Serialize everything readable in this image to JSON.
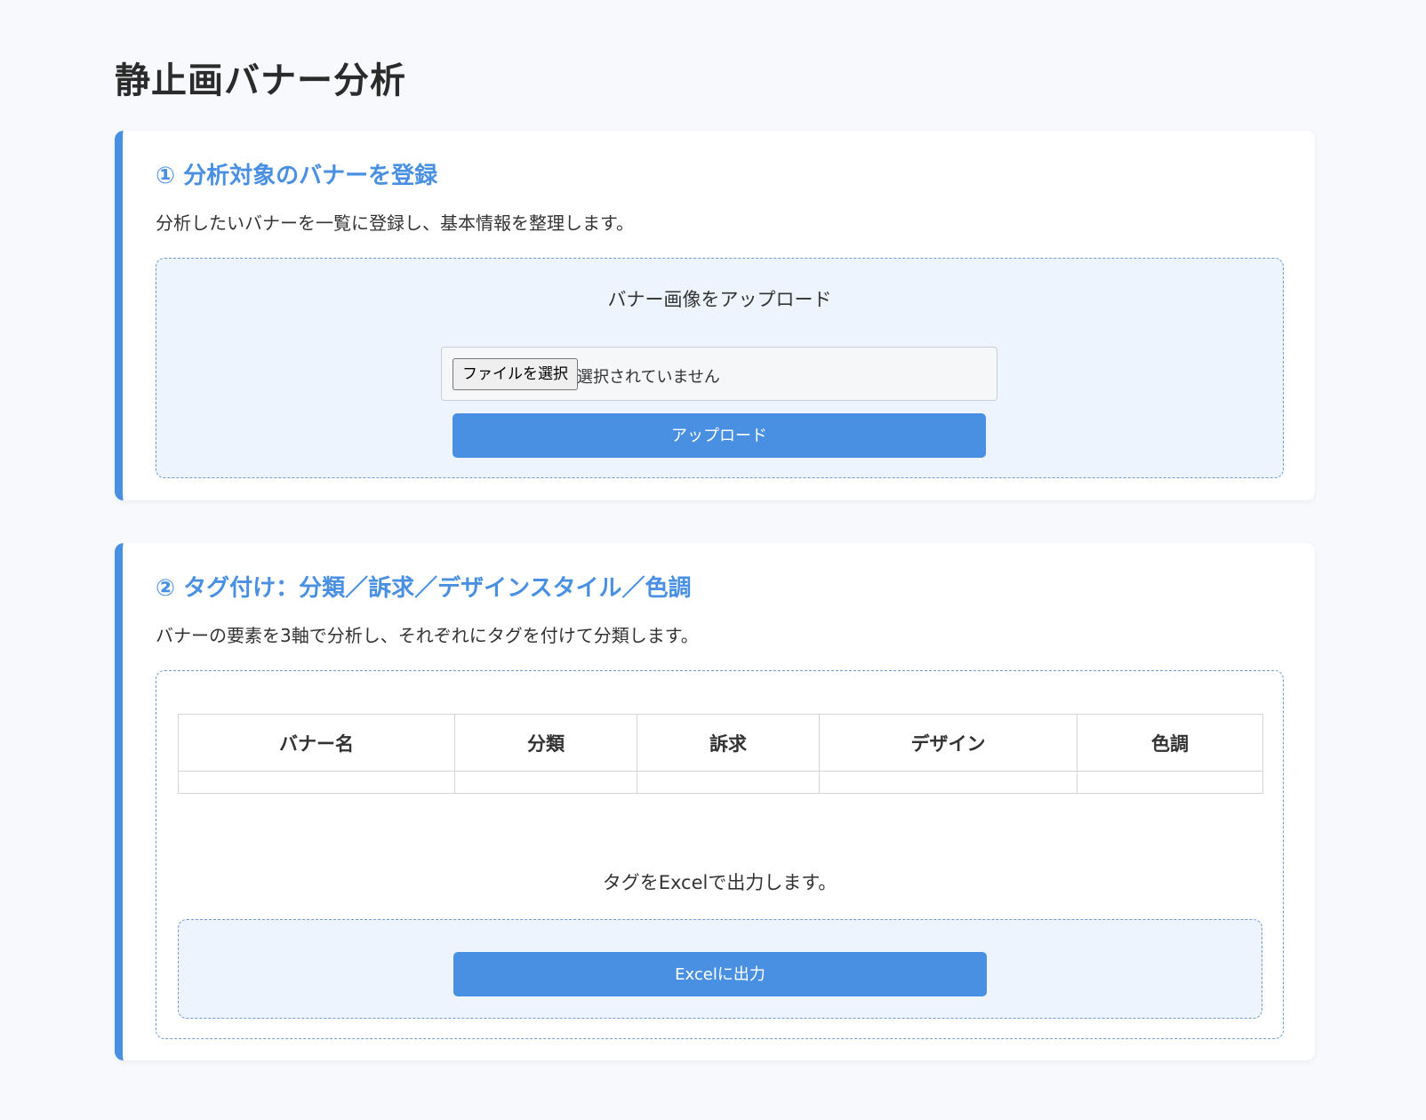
{
  "page": {
    "title": "静止画バナー分析"
  },
  "colors": {
    "accent": "#4a90e2",
    "background": "#f7f9fc",
    "panel": "#eef4fd"
  },
  "section_register": {
    "title": "① 分析対象のバナーを登録",
    "description": "分析したいバナーを一覧に登録し、基本情報を整理します。",
    "upload_label": "バナー画像をアップロード",
    "file_button_label": "ファイルを選択",
    "file_status": "選択されていません",
    "upload_button_label": "アップロード"
  },
  "section_tagging": {
    "title": "② タグ付け：分類／訴求／デザインスタイル／色調",
    "description": "バナーの要素を3軸で分析し、それぞれにタグを付けて分類します。",
    "table": {
      "headers": [
        "バナー名",
        "分類",
        "訴求",
        "デザイン",
        "色調"
      ]
    },
    "excel_note": "タグをExcelで出力します。",
    "excel_button_label": "Excelに出力"
  }
}
